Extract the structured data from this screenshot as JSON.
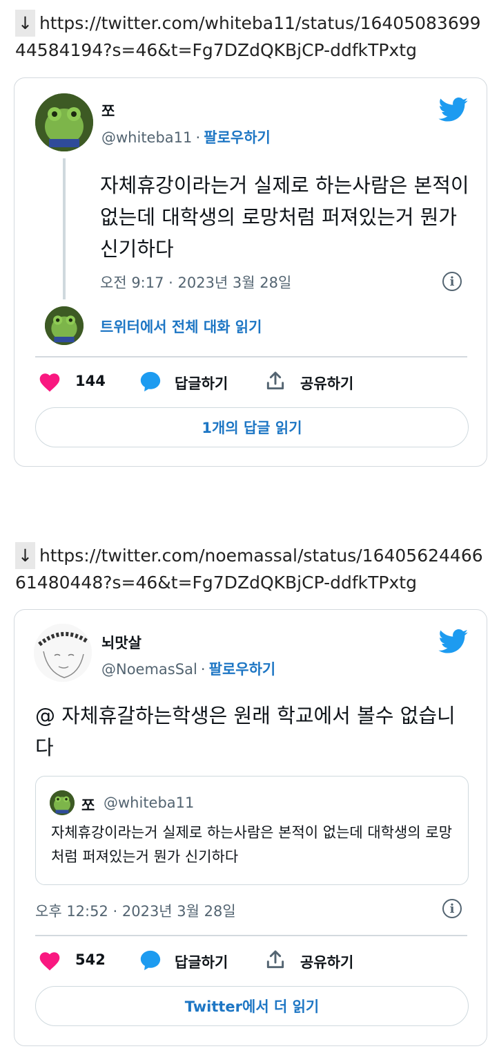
{
  "block1": {
    "arrow": "↓",
    "url": "https://twitter.com/whiteba11/status/1640508369944584194?s=46&t=Fg7DZdQKBjCP-ddfkTPxtg",
    "tweet": {
      "name": "쪼",
      "handle": "@whiteba11",
      "dot": "·",
      "follow": "팔로우하기",
      "text": "자체휴강이라는거 실제로 하는사람은 본적이 없는데 대학생의 로망처럼 퍼져있는거 뭔가 신기하다",
      "timestamp": "오전 9:17 · 2023년 3월 28일",
      "thread_link": "트위터에서 전체 대화 읽기",
      "likes": "144",
      "reply_label": "답글하기",
      "share_label": "공유하기",
      "bottom_button": "1개의 답글 읽기"
    }
  },
  "block2": {
    "arrow": "↓",
    "url": "https://twitter.com/noemassal/status/1640562446661480448?s=46&t=Fg7DZdQKBjCP-ddfkTPxtg",
    "tweet": {
      "name": "뇌맛살",
      "handle": "@NoemasSal",
      "dot": "·",
      "follow": "팔로우하기",
      "text": "@ 자체휴갈하는학생은 원래 학교에서 볼수 없습니다",
      "quote": {
        "name": "쪼",
        "handle": "@whiteba11",
        "text": "자체휴강이라는거 실제로 하는사람은 본적이 없는데 대학생의 로망처럼 퍼져있는거 뭔가 신기하다"
      },
      "timestamp": "오후 12:52 · 2023년 3월 28일",
      "likes": "542",
      "reply_label": "답글하기",
      "share_label": "공유하기",
      "bottom_button": "Twitter에서 더 읽기"
    }
  },
  "colors": {
    "accent": "#1d9bf0",
    "link": "#1d76c4",
    "heart": "#f91880",
    "muted": "#536471"
  },
  "icons": [
    "twitter-bird-icon",
    "info-icon",
    "heart-icon",
    "reply-bubble-icon",
    "share-icon"
  ]
}
